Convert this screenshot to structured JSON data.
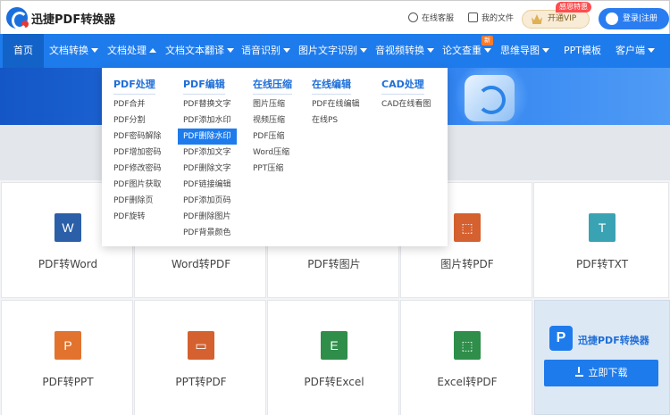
{
  "header": {
    "brand": "迅捷PDF转换器",
    "service": "在线客服",
    "my_files": "我的文件",
    "vip_label": "开通VIP",
    "vip_badge": "感恩特惠",
    "login_label": "登录|注册"
  },
  "nav": {
    "home": "首页",
    "items": [
      "文档转换",
      "文档处理",
      "文档文本翻译",
      "语音识别",
      "图片文字识别",
      "音视频转换",
      "论文查重",
      "思维导图",
      "PPT模板",
      "客户端"
    ],
    "new_badge": "新"
  },
  "dropdown": {
    "columns": [
      {
        "title": "PDF处理",
        "links": [
          "PDF合并",
          "PDF分割",
          "PDF密码解除",
          "PDF增加密码",
          "PDF修改密码",
          "PDF图片获取",
          "PDF删除页",
          "PDF旋转"
        ]
      },
      {
        "title": "PDF编辑",
        "links": [
          "PDF替换文字",
          "PDF添加水印",
          "PDF删除水印",
          "PDF添加文字",
          "PDF删除文字",
          "PDF链接编辑",
          "PDF添加页码",
          "PDF删除图片",
          "PDF背景颜色"
        ],
        "selected_index": 2
      },
      {
        "title": "在线压缩",
        "links": [
          "图片压缩",
          "视频压缩",
          "PDF压缩",
          "Word压缩",
          "PPT压缩"
        ]
      },
      {
        "title": "在线编辑",
        "links": [
          "PDF在线编辑",
          "在线PS"
        ]
      },
      {
        "title": "CAD处理",
        "links": [
          "CAD在线看图"
        ]
      }
    ]
  },
  "tools": {
    "row1": [
      {
        "label": "PDF转Word",
        "icon": "W",
        "color": "#2b5fa8"
      },
      {
        "label": "Word转PDF",
        "icon": "",
        "color": "#2b5fa8"
      },
      {
        "label": "PDF转图片",
        "icon": "",
        "color": "#2aa66a"
      },
      {
        "label": "图片转PDF",
        "icon": "pdf-icon",
        "color": "#d4612f"
      },
      {
        "label": "PDF转TXT",
        "icon": "T",
        "color": "#3aa3b3"
      }
    ],
    "row2": [
      {
        "label": "PDF转PPT",
        "icon": "P",
        "color": "#e2732e"
      },
      {
        "label": "PPT转PDF",
        "icon": "ppt-icon",
        "color": "#d4612f"
      },
      {
        "label": "PDF转Excel",
        "icon": "E",
        "color": "#2e8e4a"
      },
      {
        "label": "Excel转PDF",
        "icon": "pdf-icon",
        "color": "#2e8e4a"
      }
    ]
  },
  "promo": {
    "name": "迅捷PDF转换器",
    "logo_letter": "P",
    "download": "立即下载"
  }
}
